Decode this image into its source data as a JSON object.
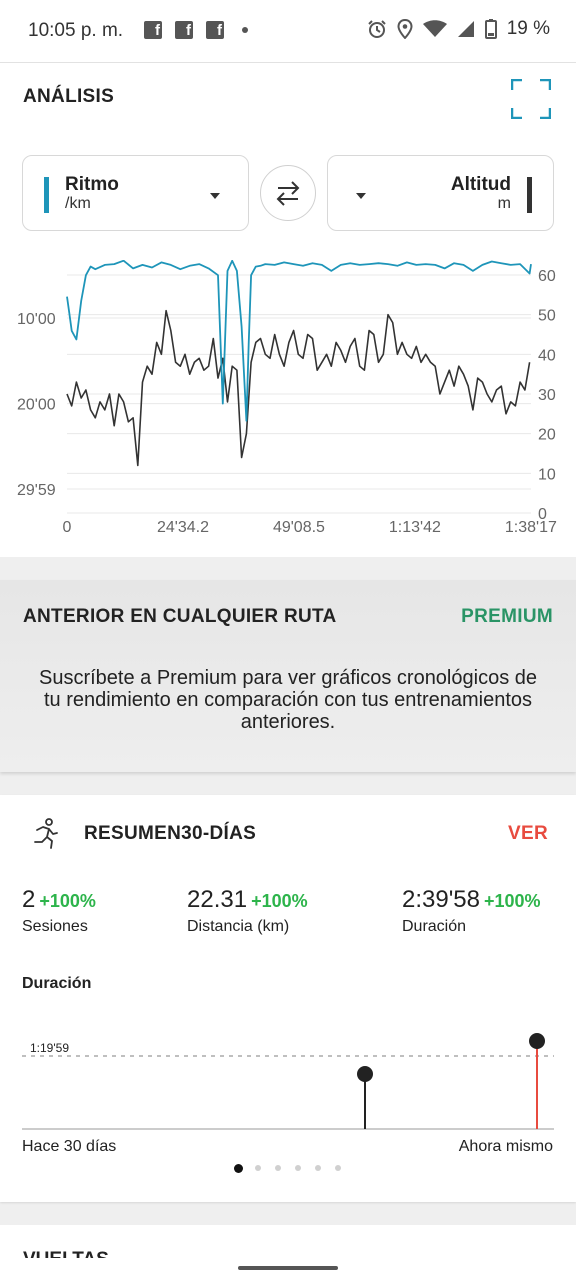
{
  "status_bar": {
    "time": "10:05 p. m.",
    "battery": "19 %"
  },
  "analysis": {
    "title": "ANÁLISIS",
    "left_metric": {
      "label": "Ritmo",
      "unit": "/km"
    },
    "right_metric": {
      "label": "Altitud",
      "unit": "m"
    },
    "colors": {
      "pace": "#1e95b9",
      "altitude": "#333333"
    },
    "chart_data": {
      "type": "line",
      "x_ticks": [
        "0",
        "24'34.2",
        "49'08.5",
        "1:13'42",
        "1:38'17"
      ],
      "y_left_ticks": [
        "10'00",
        "20'00",
        "29'59"
      ],
      "y_right_ticks": [
        "60",
        "50",
        "40",
        "30",
        "20",
        "10",
        "0"
      ],
      "y_right_range": [
        0,
        60
      ],
      "series": [
        {
          "name": "Ritmo",
          "y_axis": "left",
          "x_min": [
            0,
            0.5,
            1,
            2,
            3,
            4,
            5,
            6,
            8,
            10,
            12,
            14,
            16,
            18,
            20,
            22,
            24,
            26,
            28,
            30,
            32,
            33,
            34,
            35,
            36,
            37,
            38,
            38.5,
            39,
            40,
            41,
            42,
            44,
            46,
            48,
            50,
            52,
            54,
            56,
            58,
            60,
            62,
            64,
            66,
            68,
            70,
            72,
            74,
            76,
            78,
            80,
            82,
            84,
            86,
            88,
            90,
            92,
            94,
            96,
            98,
            98.3
          ],
          "values_min_per_km": [
            7.5,
            9.5,
            11.5,
            12.5,
            8,
            5,
            4,
            4.3,
            3.8,
            3.7,
            3.3,
            4.2,
            3.8,
            4.1,
            3.5,
            3.8,
            4.3,
            3.9,
            3.7,
            4.2,
            5,
            20,
            4.5,
            3.3,
            4.5,
            11,
            22,
            13,
            5,
            4,
            3.9,
            3.7,
            3.8,
            3.5,
            3.7,
            3.9,
            3.6,
            3.8,
            4.5,
            3.8,
            3.6,
            3.8,
            3.7,
            3.6,
            3.7,
            3.9,
            3.5,
            3.8,
            3.7,
            3.8,
            4.2,
            3.6,
            3.8,
            4.5,
            3.8,
            3.4,
            3.6,
            3.8,
            3.7,
            4.8,
            3.7
          ]
        },
        {
          "name": "Altitud",
          "y_axis": "right",
          "x_min": [
            0,
            1,
            2,
            3,
            4,
            5,
            6,
            7,
            8,
            9,
            10,
            11,
            12,
            13,
            14,
            15,
            16,
            17,
            18,
            19,
            20,
            21,
            22,
            23,
            24,
            25,
            26,
            27,
            28,
            29,
            30,
            31,
            32,
            33,
            34,
            35,
            36,
            37,
            38,
            39,
            40,
            41,
            42,
            43,
            44,
            45,
            46,
            47,
            48,
            49,
            50,
            51,
            52,
            53,
            54,
            55,
            56,
            57,
            58,
            59,
            60,
            61,
            62,
            63,
            64,
            65,
            66,
            67,
            68,
            69,
            70,
            71,
            72,
            73,
            74,
            75,
            76,
            77,
            78,
            79,
            80,
            81,
            82,
            83,
            84,
            85,
            86,
            87,
            88,
            89,
            90,
            91,
            92,
            93,
            94,
            95,
            96,
            97,
            98
          ],
          "values_m": [
            30,
            27,
            33,
            29,
            31,
            26,
            24,
            28,
            26,
            30,
            22,
            30,
            28,
            23,
            24,
            12,
            33,
            37,
            35,
            43,
            40,
            51,
            46,
            38,
            37,
            40,
            35,
            38,
            39,
            36,
            37,
            44,
            34,
            39,
            28,
            37,
            36,
            14,
            20,
            38,
            43,
            44,
            40,
            39,
            45,
            40,
            37,
            43,
            46,
            40,
            39,
            45,
            44,
            36,
            38,
            40,
            37,
            43,
            41,
            38,
            42,
            44,
            37,
            36,
            46,
            45,
            38,
            40,
            50,
            48,
            40,
            43,
            40,
            39,
            42,
            38,
            40,
            38,
            37,
            30,
            33,
            36,
            32,
            37,
            35,
            32,
            26,
            34,
            33,
            30,
            28,
            31,
            32,
            25,
            28,
            27,
            33,
            31,
            38
          ]
        }
      ]
    }
  },
  "previous": {
    "title": "ANTERIOR EN CUALQUIER RUTA",
    "premium_label": "PREMIUM",
    "message": "Suscríbete a Premium para ver gráficos cronológicos de tu rendimiento en comparación con tus entrenamientos anteriores."
  },
  "summary": {
    "title": "RESUMEN30-DÍAS",
    "ver_label": "VER",
    "stats": [
      {
        "value": "2",
        "pct": "+100%",
        "label": "Sesiones"
      },
      {
        "value": "22.31",
        "pct": "+100%",
        "label": "Distancia (km)"
      },
      {
        "value": "2:39'58",
        "pct": "+100%",
        "label": "Duración"
      }
    ],
    "duration_title": "Duración",
    "avg_label": "1:19'59",
    "start_label": "Hace 30 días",
    "end_label": "Ahora mismo",
    "page_count": 6,
    "active_page": 1
  },
  "next_section_title": "VUELTAS"
}
